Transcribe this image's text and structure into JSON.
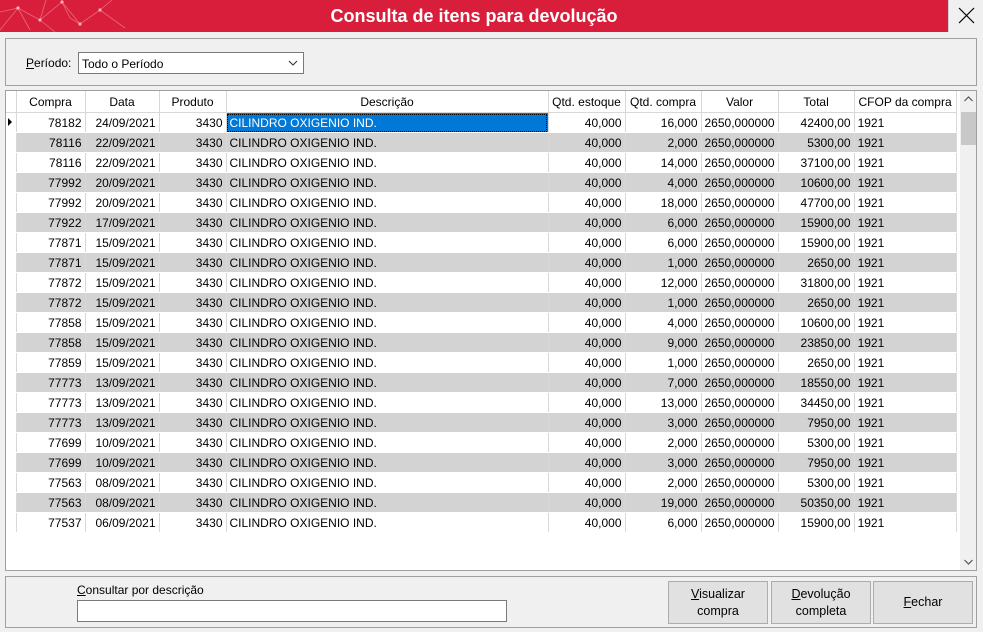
{
  "window": {
    "title": "Consulta de itens para devolução"
  },
  "filter": {
    "label_underline": "P",
    "label_rest": "eríodo:",
    "selected": "Todo o Período"
  },
  "grid": {
    "columns": [
      "Compra",
      "Data",
      "Produto",
      "Descrição",
      "Qtd. estoque",
      "Qtd. compra",
      "Valor",
      "Total",
      "CFOP da compra"
    ],
    "rows": [
      [
        "78182",
        "24/09/2021",
        "3430",
        "CILINDRO OXIGENIO IND.",
        "40,000",
        "16,000",
        "2650,000000",
        "42400,00",
        "1921"
      ],
      [
        "78116",
        "22/09/2021",
        "3430",
        "CILINDRO OXIGENIO IND.",
        "40,000",
        "2,000",
        "2650,000000",
        "5300,00",
        "1921"
      ],
      [
        "78116",
        "22/09/2021",
        "3430",
        "CILINDRO OXIGENIO IND.",
        "40,000",
        "14,000",
        "2650,000000",
        "37100,00",
        "1921"
      ],
      [
        "77992",
        "20/09/2021",
        "3430",
        "CILINDRO OXIGENIO IND.",
        "40,000",
        "4,000",
        "2650,000000",
        "10600,00",
        "1921"
      ],
      [
        "77992",
        "20/09/2021",
        "3430",
        "CILINDRO OXIGENIO IND.",
        "40,000",
        "18,000",
        "2650,000000",
        "47700,00",
        "1921"
      ],
      [
        "77922",
        "17/09/2021",
        "3430",
        "CILINDRO OXIGENIO IND.",
        "40,000",
        "6,000",
        "2650,000000",
        "15900,00",
        "1921"
      ],
      [
        "77871",
        "15/09/2021",
        "3430",
        "CILINDRO OXIGENIO IND.",
        "40,000",
        "6,000",
        "2650,000000",
        "15900,00",
        "1921"
      ],
      [
        "77871",
        "15/09/2021",
        "3430",
        "CILINDRO OXIGENIO IND.",
        "40,000",
        "1,000",
        "2650,000000",
        "2650,00",
        "1921"
      ],
      [
        "77872",
        "15/09/2021",
        "3430",
        "CILINDRO OXIGENIO IND.",
        "40,000",
        "12,000",
        "2650,000000",
        "31800,00",
        "1921"
      ],
      [
        "77872",
        "15/09/2021",
        "3430",
        "CILINDRO OXIGENIO IND.",
        "40,000",
        "1,000",
        "2650,000000",
        "2650,00",
        "1921"
      ],
      [
        "77858",
        "15/09/2021",
        "3430",
        "CILINDRO OXIGENIO IND.",
        "40,000",
        "4,000",
        "2650,000000",
        "10600,00",
        "1921"
      ],
      [
        "77858",
        "15/09/2021",
        "3430",
        "CILINDRO OXIGENIO IND.",
        "40,000",
        "9,000",
        "2650,000000",
        "23850,00",
        "1921"
      ],
      [
        "77859",
        "15/09/2021",
        "3430",
        "CILINDRO OXIGENIO IND.",
        "40,000",
        "1,000",
        "2650,000000",
        "2650,00",
        "1921"
      ],
      [
        "77773",
        "13/09/2021",
        "3430",
        "CILINDRO OXIGENIO IND.",
        "40,000",
        "7,000",
        "2650,000000",
        "18550,00",
        "1921"
      ],
      [
        "77773",
        "13/09/2021",
        "3430",
        "CILINDRO OXIGENIO IND.",
        "40,000",
        "13,000",
        "2650,000000",
        "34450,00",
        "1921"
      ],
      [
        "77773",
        "13/09/2021",
        "3430",
        "CILINDRO OXIGENIO IND.",
        "40,000",
        "3,000",
        "2650,000000",
        "7950,00",
        "1921"
      ],
      [
        "77699",
        "10/09/2021",
        "3430",
        "CILINDRO OXIGENIO IND.",
        "40,000",
        "2,000",
        "2650,000000",
        "5300,00",
        "1921"
      ],
      [
        "77699",
        "10/09/2021",
        "3430",
        "CILINDRO OXIGENIO IND.",
        "40,000",
        "3,000",
        "2650,000000",
        "7950,00",
        "1921"
      ],
      [
        "77563",
        "08/09/2021",
        "3430",
        "CILINDRO OXIGENIO IND.",
        "40,000",
        "2,000",
        "2650,000000",
        "5300,00",
        "1921"
      ],
      [
        "77563",
        "08/09/2021",
        "3430",
        "CILINDRO OXIGENIO IND.",
        "40,000",
        "19,000",
        "2650,000000",
        "50350,00",
        "1921"
      ],
      [
        "77537",
        "06/09/2021",
        "3430",
        "CILINDRO OXIGENIO IND.",
        "40,000",
        "6,000",
        "2650,000000",
        "15900,00",
        "1921"
      ]
    ]
  },
  "search": {
    "label_underline": "C",
    "label_rest": "onsultar por descrição",
    "value": ""
  },
  "buttons": {
    "visualizar": {
      "u": "V",
      "line1": "isualizar",
      "line2": "compra"
    },
    "devolucao": {
      "u": "D",
      "line1": "evolução",
      "line2": "completa"
    },
    "fechar": {
      "u": "F",
      "line1": "echar"
    }
  },
  "colors": {
    "titlebar": "#d81e3a",
    "selection": "#0078d7",
    "alt_row": "#d3d3d3"
  }
}
